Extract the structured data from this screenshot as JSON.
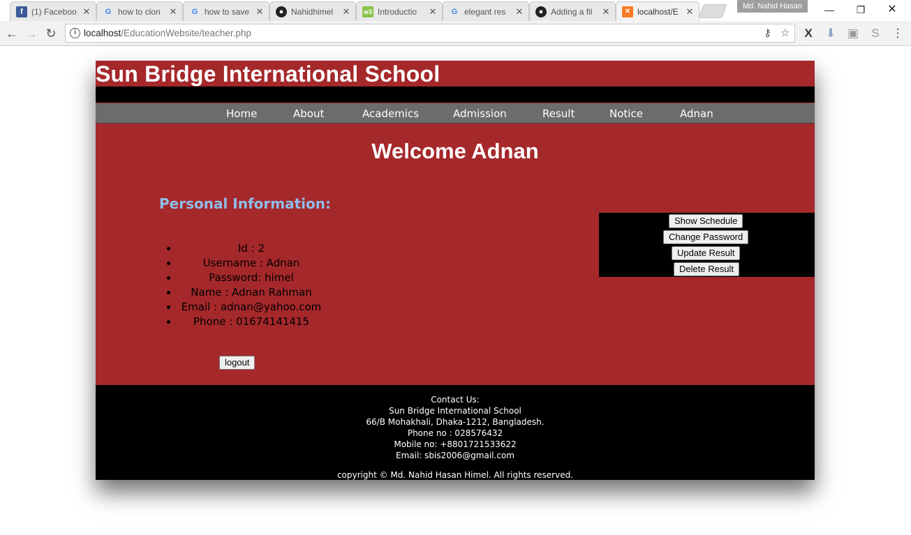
{
  "browser": {
    "tabs": [
      {
        "title": "(1) Faceboo",
        "icon": "facebook-icon"
      },
      {
        "title": "how to clon",
        "icon": "google-icon"
      },
      {
        "title": "how to save",
        "icon": "google-icon"
      },
      {
        "title": "Nahidhimel",
        "icon": "github-icon"
      },
      {
        "title": "Introductio",
        "icon": "w3-icon"
      },
      {
        "title": "elegant res",
        "icon": "google-icon"
      },
      {
        "title": "Adding a fil",
        "icon": "github-icon"
      },
      {
        "title": "localhost/E",
        "icon": "xampp-icon"
      }
    ],
    "profile_name": "Md. Nahid Hasan",
    "url_host": "localhost",
    "url_path": "/EducationWebsite/teacher.php"
  },
  "site": {
    "title": "Sun Bridge International School",
    "nav": [
      "Home",
      "About",
      "Academics",
      "Admission",
      "Result",
      "Notice",
      "Adnan"
    ],
    "welcome": "Welcome Adnan",
    "personal_title": "Personal Information:",
    "personal": [
      "Id :  2",
      "Username : Adnan",
      "Password: himel",
      "Name : Adnan Rahman",
      "Email : adnan@yahoo.com",
      "Phone : 01674141415"
    ],
    "logout_label": "logout",
    "actions": [
      "Show Schedule",
      "Change Password",
      "Update Result",
      "Delete Result"
    ],
    "colors": {
      "primary": "#a5282b",
      "nav": "#6c6c6c",
      "heading_accent": "#8fbde8"
    }
  },
  "footer": {
    "contact_title": "Contact Us:",
    "school": "Sun Bridge International School",
    "address": "66/B Mohakhali, Dhaka-1212, Bangladesh.",
    "phone": "Phone no : 028576432",
    "mobile": "Mobile no: +8801721533622",
    "email": "Email: sbis2006@gmail.com",
    "copyright": "copyright © Md. Nahid Hasan Himel. All rights reserved."
  }
}
